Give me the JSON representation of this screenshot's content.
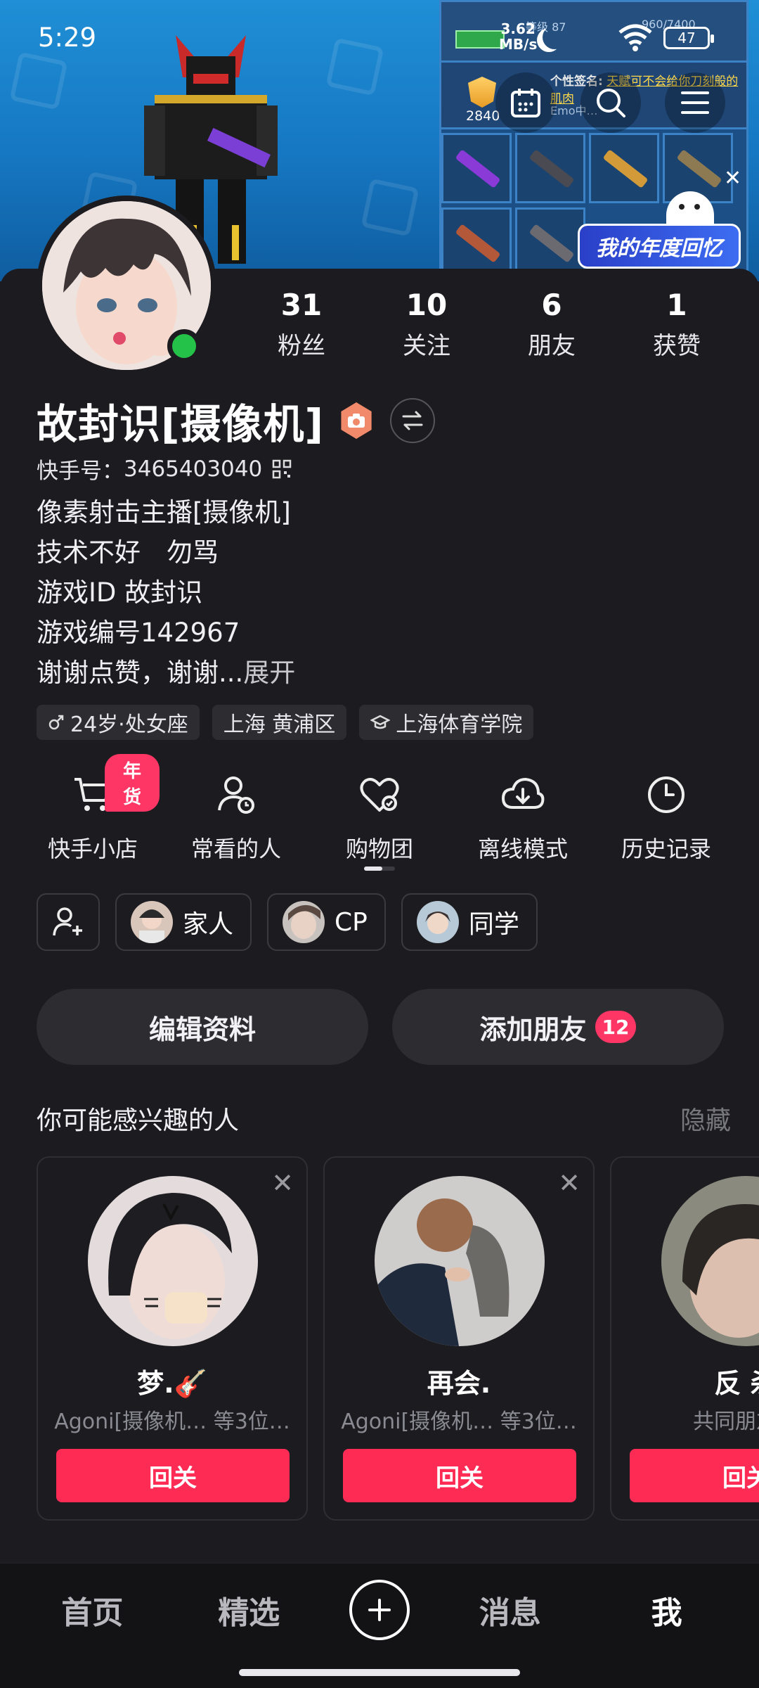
{
  "status_bar": {
    "time": "5:29",
    "net_speed_value": "3.62",
    "net_speed_unit": "MB/s",
    "battery": "47"
  },
  "banner": {
    "review_label": "我的年度回忆",
    "game_level_label": "等级 87",
    "game_xp": "960/7400",
    "game_signature_prefix": "个性签名:",
    "game_signature": "天赋可不会给你刀刻般的肌肉",
    "game_emo": "Emo中…",
    "game_badge_number": "2840"
  },
  "stats": [
    {
      "value": "31",
      "label": "粉丝"
    },
    {
      "value": "10",
      "label": "关注"
    },
    {
      "value": "6",
      "label": "朋友"
    },
    {
      "value": "1",
      "label": "获赞"
    }
  ],
  "profile": {
    "name": "故封识[摄像机]",
    "kid_label": "快手号：",
    "kid_value": "3465403040",
    "bio_lines": [
      "像素射击主播[摄像机]",
      "技术不好　勿骂",
      "游戏ID  故封识",
      "游戏编号142967"
    ],
    "bio_last": "谢谢点赞，谢谢...",
    "bio_expand": "展开"
  },
  "tags": [
    {
      "icon": "male-icon",
      "text": "24岁·处女座"
    },
    {
      "icon": "",
      "text": "上海 黄浦区"
    },
    {
      "icon": "school-icon",
      "text": "上海体育学院"
    }
  ],
  "shortcuts": [
    {
      "icon": "cart-icon",
      "label": "快手小店",
      "promo": "年货"
    },
    {
      "icon": "frequent-people-icon",
      "label": "常看的人"
    },
    {
      "icon": "heart-group-icon",
      "label": "购物团"
    },
    {
      "icon": "cloud-download-icon",
      "label": "离线模式"
    },
    {
      "icon": "clock-icon",
      "label": "历史记录"
    }
  ],
  "relations": [
    "家人",
    "CP",
    "同学"
  ],
  "actions": {
    "edit": "编辑资料",
    "add_friend": "添加朋友",
    "add_friend_count": "12"
  },
  "suggestions": {
    "title": "你可能感兴趣的人",
    "hide": "隐藏",
    "cards": [
      {
        "name": "梦.🎸",
        "sub": "Agoni[摄像机… 等3位…",
        "button": "回关"
      },
      {
        "name": "再会.",
        "sub": "Agoni[摄像机… 等3位…",
        "button": "回关"
      },
      {
        "name": "反 杀",
        "sub": "共同朋友：",
        "button": "回关"
      }
    ]
  },
  "bottom_nav": [
    "首页",
    "精选",
    "消息",
    "我"
  ],
  "colors": {
    "accent": "#fe2c55",
    "badge": "#fe3666",
    "online": "#25c24a",
    "background": "#1c1c20"
  }
}
